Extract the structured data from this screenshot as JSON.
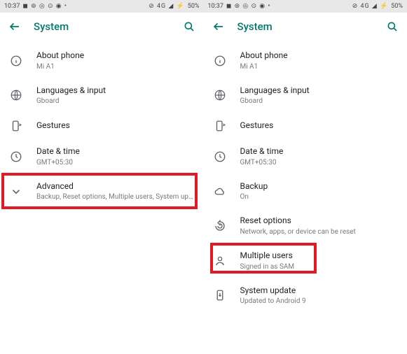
{
  "status": {
    "time": "10:37",
    "icons_left": "◼ ⊚ ◎ ⊙ ◉ •",
    "icons_right": "⊘ 4G ◢ ⚡",
    "battery": "50%"
  },
  "appbar": {
    "title": "System"
  },
  "rows_common": {
    "about_title": "About phone",
    "about_sub": "Mi A1",
    "lang_title": "Languages & input",
    "lang_sub": "Gboard",
    "gestures_title": "Gestures",
    "date_title": "Date & time",
    "date_sub": "GMT+05:30"
  },
  "left": {
    "advanced_title": "Advanced",
    "advanced_sub": "Backup, Reset options, Multiple users, System updat…"
  },
  "right": {
    "backup_title": "Backup",
    "backup_sub": "On",
    "reset_title": "Reset options",
    "reset_sub": "Network, apps, or device can be reset",
    "multi_title": "Multiple users",
    "multi_sub": "Signed in as SAM",
    "update_title": "System update",
    "update_sub": "Updated to Android 9"
  }
}
